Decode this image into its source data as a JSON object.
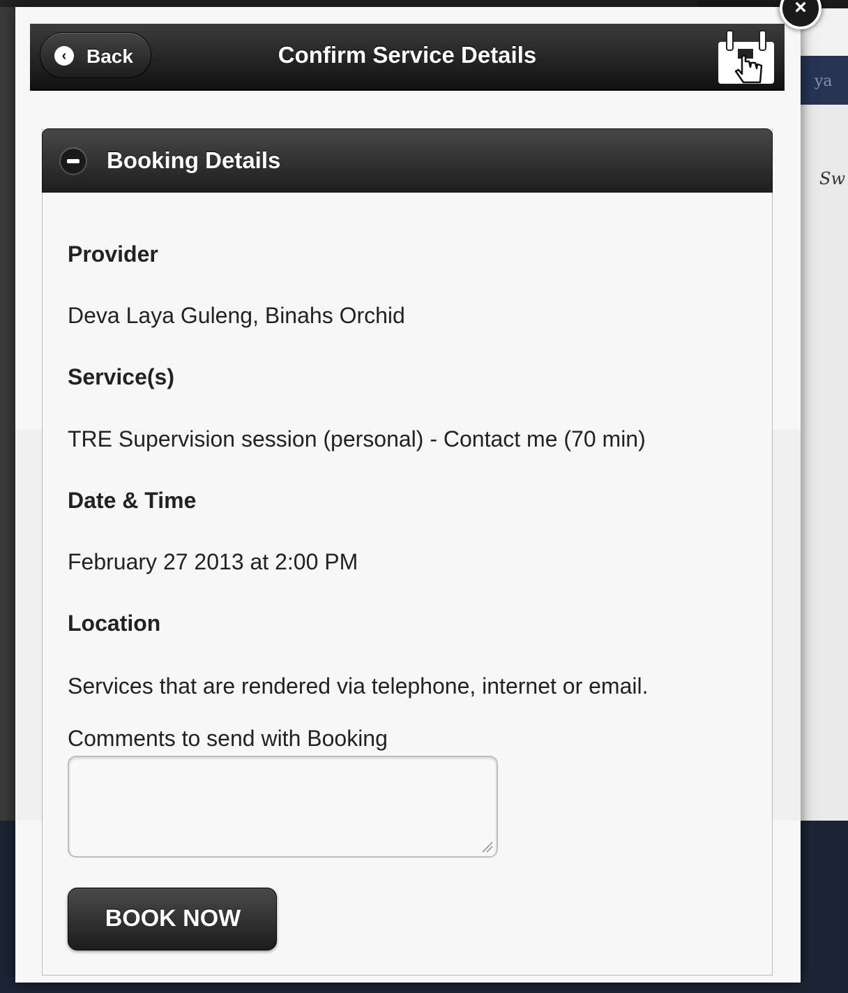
{
  "header": {
    "back_label": "Back",
    "title": "Confirm Service Details"
  },
  "background": {
    "nav_text": "ya",
    "side_text": "Sw"
  },
  "section": {
    "title": "Booking Details"
  },
  "fields": {
    "provider_label": "Provider",
    "provider_value": "Deva Laya Guleng, Binahs Orchid",
    "service_label": "Service(s)",
    "service_value": "TRE Supervision session (personal) - Contact me (70 min)",
    "datetime_label": "Date & Time",
    "datetime_value": "February 27 2013 at 2:00 PM",
    "location_label": "Location",
    "location_value": "Services that are rendered via telephone, internet or email."
  },
  "comments": {
    "label": "Comments to send with Booking",
    "value": ""
  },
  "actions": {
    "book_label": "BOOK NOW"
  }
}
